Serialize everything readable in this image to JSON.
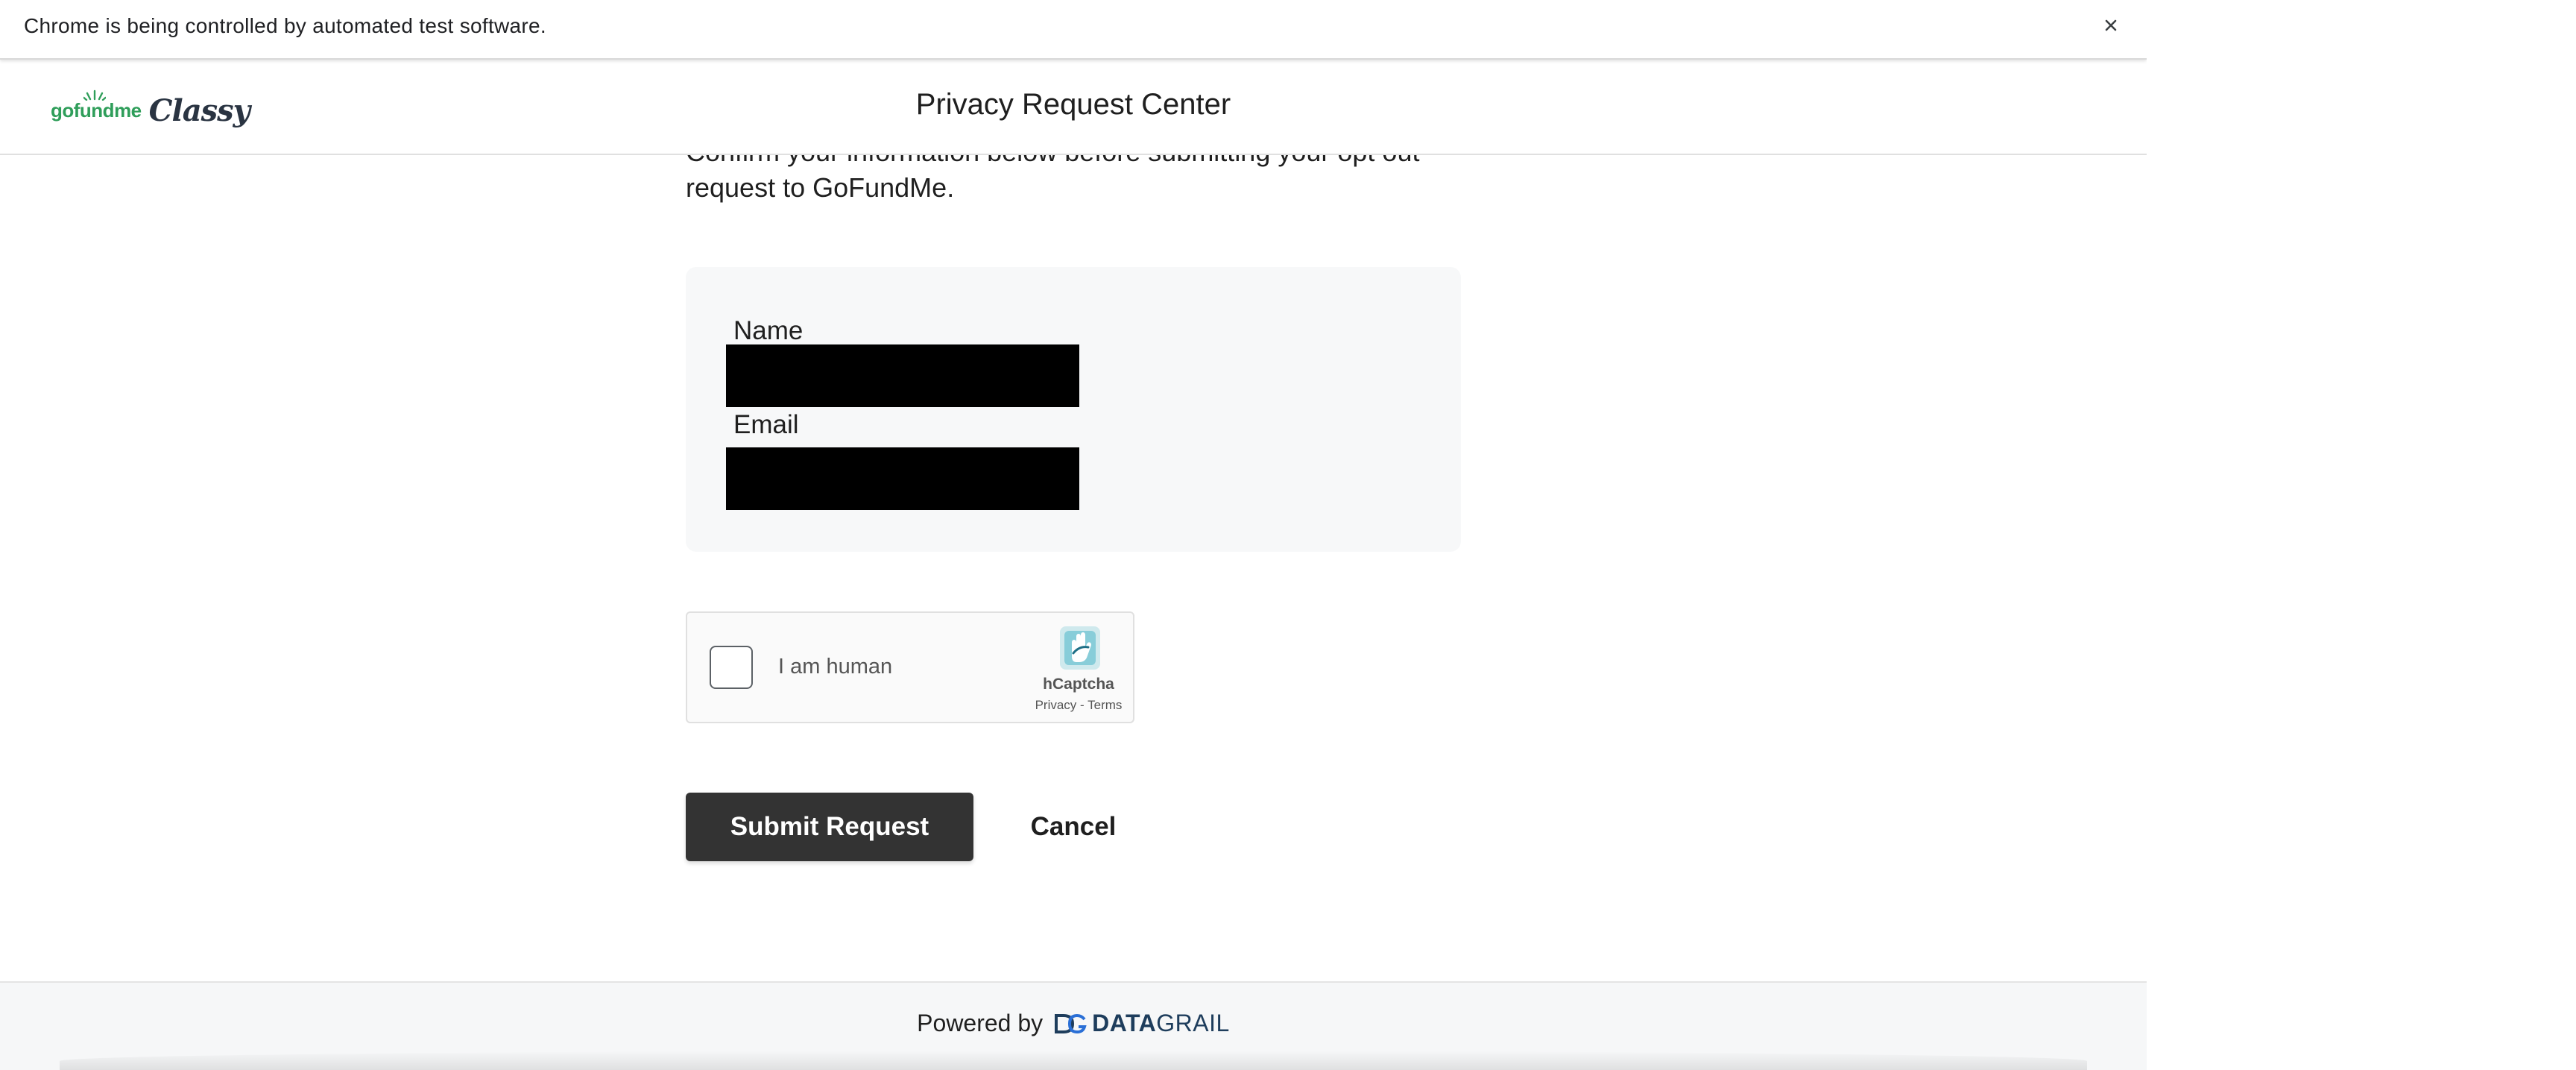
{
  "infobar": {
    "message": "Chrome is being controlled by automated test software.",
    "close_icon": "close-icon"
  },
  "header": {
    "logo_primary": "gofundme",
    "logo_secondary": "Classy",
    "title": "Privacy Request Center"
  },
  "main": {
    "intro_line1": "Confirm your information below before submitting your opt out",
    "intro_line2": "request to GoFundMe.",
    "fields": {
      "name_label": "Name",
      "email_label": "Email"
    }
  },
  "captcha": {
    "label": "I am human",
    "brand": "hCaptcha",
    "privacy_link": "Privacy",
    "separator": " - ",
    "terms_link": "Terms",
    "logo_icon": "hcaptcha-hand-icon",
    "logo_color": "#4fb7c9"
  },
  "actions": {
    "submit_label": "Submit Request",
    "cancel_label": "Cancel"
  },
  "footer": {
    "powered_by": "Powered by",
    "brand_bold": "DATA",
    "brand_light": "GRAIL",
    "brand_icon": "datagrail-logo-icon",
    "brand_color": "#1e3d5c"
  },
  "colors": {
    "logo_green": "#2f9e5a",
    "logo_dark": "#2a3442",
    "submit_bg": "#333333",
    "panel_bg": "#f7f8f9"
  }
}
